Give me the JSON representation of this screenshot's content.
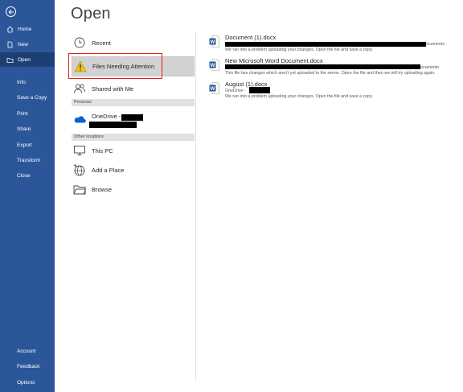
{
  "sidebar": {
    "items": [
      {
        "label": "Home",
        "icon": "home-icon"
      },
      {
        "label": "New",
        "icon": "new-document-icon"
      },
      {
        "label": "Open",
        "icon": "open-folder-icon"
      }
    ],
    "commands": [
      "Info",
      "Save a Copy",
      "Print",
      "Share",
      "Export",
      "Transform",
      "Close"
    ],
    "footer": [
      "Account",
      "Feedback",
      "Options"
    ]
  },
  "main": {
    "title": "Open",
    "locations": {
      "recent": "Recent",
      "files_needing_attention": "Files Needing Attention",
      "shared_with_me": "Shared with Me",
      "personal_header": "Personal",
      "onedrive": "OneDrive -",
      "other_header": "Other locations",
      "this_pc": "This PC",
      "add_place": "Add a Place",
      "browse": "Browse"
    },
    "files": [
      {
        "name": "Document (1).docx",
        "path_suffix": "ocuments",
        "message": "We ran into a problem uploading your changes. Open the file and save a copy."
      },
      {
        "name": "New Microsoft Word Document.docx",
        "path_suffix": "ocuments",
        "message": "This file has changes which aren't yet uploaded to the server. Open the file and then we will try uploading again."
      },
      {
        "name": "August (1).docx",
        "path_prefix": "OneDrive -",
        "message": "We ran into a problem uploading your changes. Open the file and save a copy."
      }
    ]
  },
  "colors": {
    "sidebar": "#2b579a",
    "sidebar_active": "#1e3f73",
    "highlight": "#e0201b",
    "word_blue": "#2b579a"
  }
}
